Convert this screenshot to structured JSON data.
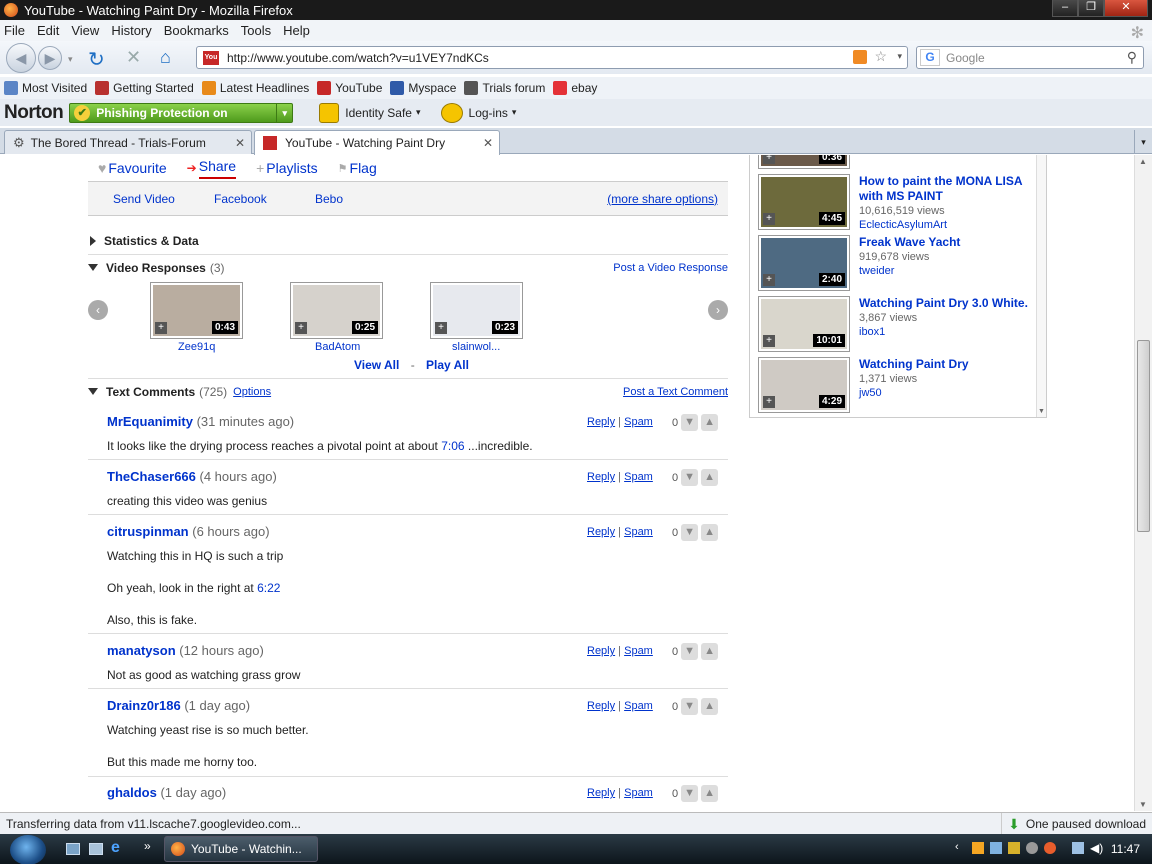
{
  "window": {
    "title": "YouTube - Watching Paint Dry - Mozilla Firefox"
  },
  "menu": [
    "File",
    "Edit",
    "View",
    "History",
    "Bookmarks",
    "Tools",
    "Help"
  ],
  "nav": {
    "url": "http://www.youtube.com/watch?v=u1VEY7ndKCs",
    "search_placeholder": "Google"
  },
  "bookmarks": [
    {
      "label": "Most Visited",
      "icon": "most-visited-icon",
      "color": "#5b85c6"
    },
    {
      "label": "Getting Started",
      "icon": "firefox-getting-started-icon",
      "color": "#b8312f"
    },
    {
      "label": "Latest Headlines",
      "icon": "rss-icon",
      "color": "#e88a1a"
    },
    {
      "label": "YouTube",
      "icon": "youtube-icon",
      "color": "#c62828"
    },
    {
      "label": "Myspace",
      "icon": "myspace-icon",
      "color": "#2f5aa8"
    },
    {
      "label": "Trials forum",
      "icon": "gear-icon",
      "color": "#555555"
    },
    {
      "label": "ebay",
      "icon": "ebay-icon",
      "color": "#e43137"
    }
  ],
  "norton": {
    "logo": "Norton",
    "phishing": "Phishing Protection on",
    "identity": "Identity Safe",
    "logins": "Log-ins"
  },
  "tabs": [
    {
      "label": "The Bored Thread - Trials-Forum",
      "active": false
    },
    {
      "label": "YouTube - Watching Paint Dry",
      "active": true
    }
  ],
  "share": {
    "favourite": "Favourite",
    "share": "Share",
    "playlists": "Playlists",
    "flag": "Flag",
    "send_video": "Send Video",
    "facebook": "Facebook",
    "bebo": "Bebo",
    "more": "(more share options)"
  },
  "statistics": {
    "label": "Statistics & Data"
  },
  "video_responses": {
    "label": "Video Responses",
    "count": "(3)",
    "post": "Post a Video Response",
    "items": [
      {
        "user": "Zee91q",
        "duration": "0:43",
        "color": "#b9ada0"
      },
      {
        "user": "BadAtom",
        "duration": "0:25",
        "color": "#d6d2cc"
      },
      {
        "user": "slainwol...",
        "duration": "0:23",
        "color": "#e7e9ee"
      }
    ],
    "view_all": "View All",
    "sep": "-",
    "play_all": "Play All"
  },
  "text_comments": {
    "label": "Text Comments",
    "count": "(725)",
    "options": "Options",
    "post": "Post a Text Comment",
    "reply": "Reply",
    "spam": "Spam",
    "pipe": "|",
    "comments": [
      {
        "user": "MrEquanimity",
        "age": "(31 minutes ago)",
        "lines": [
          "It looks like the drying process reaches a pivotal point at about "
        ],
        "link": "7:06",
        "after": " ...incredible.",
        "votes": "0"
      },
      {
        "user": "TheChaser666",
        "age": "(4 hours ago)",
        "lines": [
          "creating this video was genius"
        ],
        "votes": "0"
      },
      {
        "user": "citruspinman",
        "age": "(6 hours ago)",
        "lines": [
          "Watching this in HQ is such a trip",
          "Oh yeah, look in the right at ",
          "Also, this is fake."
        ],
        "link": "6:22",
        "votes": "0"
      },
      {
        "user": "manatyson",
        "age": "(12 hours ago)",
        "lines": [
          "Not as good as watching grass grow"
        ],
        "votes": "0"
      },
      {
        "user": "Drainz0r186",
        "age": "(1 day ago)",
        "lines": [
          "Watching yeast rise is so much better.",
          "But this made me horny too."
        ],
        "votes": "0"
      },
      {
        "user": "ghaldos",
        "age": "(1 day ago)",
        "lines": [],
        "votes": "0"
      }
    ]
  },
  "related": [
    {
      "title": "",
      "views": "",
      "user": "",
      "duration": "0:36",
      "color": "#6b5a4a"
    },
    {
      "title": "How to paint the MONA LISA with MS PAINT",
      "views": "10,616,519 views",
      "user": "EclecticAsylumArt",
      "duration": "4:45",
      "color": "#6d6a3c"
    },
    {
      "title": "Freak Wave Yacht",
      "views": "919,678 views",
      "user": "tweider",
      "duration": "2:40",
      "color": "#4e6a82"
    },
    {
      "title": "Watching Paint Dry 3.0 White.",
      "views": "3,867 views",
      "user": "ibox1",
      "duration": "10:01",
      "color": "#d9d6cc"
    },
    {
      "title": "Watching Paint Dry",
      "views": "1,371 views",
      "user": "jw50",
      "duration": "4:29",
      "color": "#cfcac4"
    }
  ],
  "status": {
    "text": "Transferring data from v11.lscache7.googlevideo.com...",
    "download": "One paused download"
  },
  "taskbar": {
    "item": "YouTube - Watchin...",
    "clock": "11:47"
  }
}
